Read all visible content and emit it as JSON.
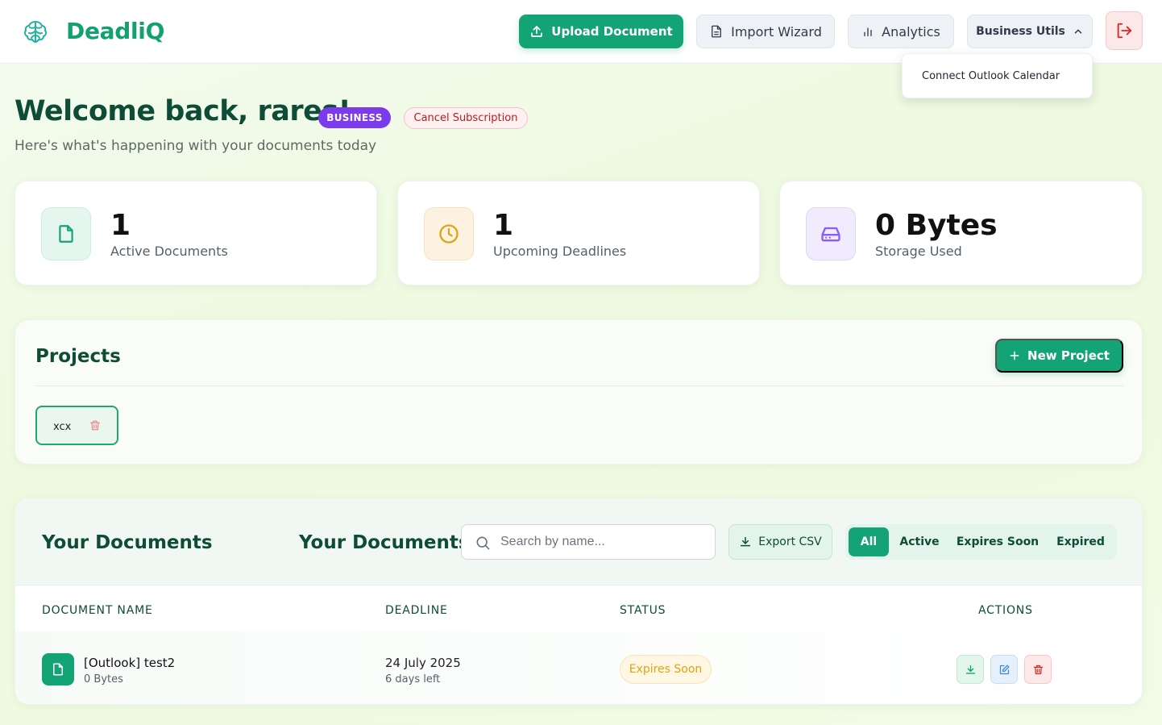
{
  "app": {
    "name": "DeadliQ"
  },
  "header": {
    "upload_label": "Upload Document",
    "import_label": "Import Wizard",
    "analytics_label": "Analytics",
    "utils_label": "Business Utils",
    "dropdown_items": [
      {
        "label": "Connect Outlook Calendar"
      }
    ]
  },
  "welcome": {
    "title": "Welcome back, rares!",
    "plan_badge": "BUSINESS",
    "cancel_label": "Cancel Subscription",
    "subtitle": "Here's what's happening with your documents today"
  },
  "stats": [
    {
      "value": "1",
      "label": "Active Documents",
      "icon": "file-icon"
    },
    {
      "value": "1",
      "label": "Upcoming Deadlines",
      "icon": "clock-icon"
    },
    {
      "value": "0 Bytes",
      "label": "Storage Used",
      "icon": "hard-drive-icon"
    }
  ],
  "projects": {
    "title": "Projects",
    "new_label": "New Project",
    "items": [
      {
        "name": "xcx"
      }
    ]
  },
  "documents": {
    "title": "Your Documents",
    "title_secondary": "Your Documents",
    "search_placeholder": "Search by name...",
    "export_label": "Export CSV",
    "filters": [
      "All",
      "Active",
      "Expires Soon",
      "Expired"
    ],
    "active_filter": "All",
    "columns": [
      "DOCUMENT NAME",
      "DEADLINE",
      "STATUS",
      "ACTIONS"
    ],
    "rows": [
      {
        "name": "[Outlook] test2",
        "size": "0 Bytes",
        "deadline": "24 July 2025",
        "days_left": "6 days left",
        "status": "Expires Soon"
      }
    ]
  },
  "colors": {
    "brand": "#14a374",
    "heading": "#0e4c37",
    "business_badge": "#7c3aed",
    "warning": "#e0a314",
    "danger": "#b91c1c"
  }
}
